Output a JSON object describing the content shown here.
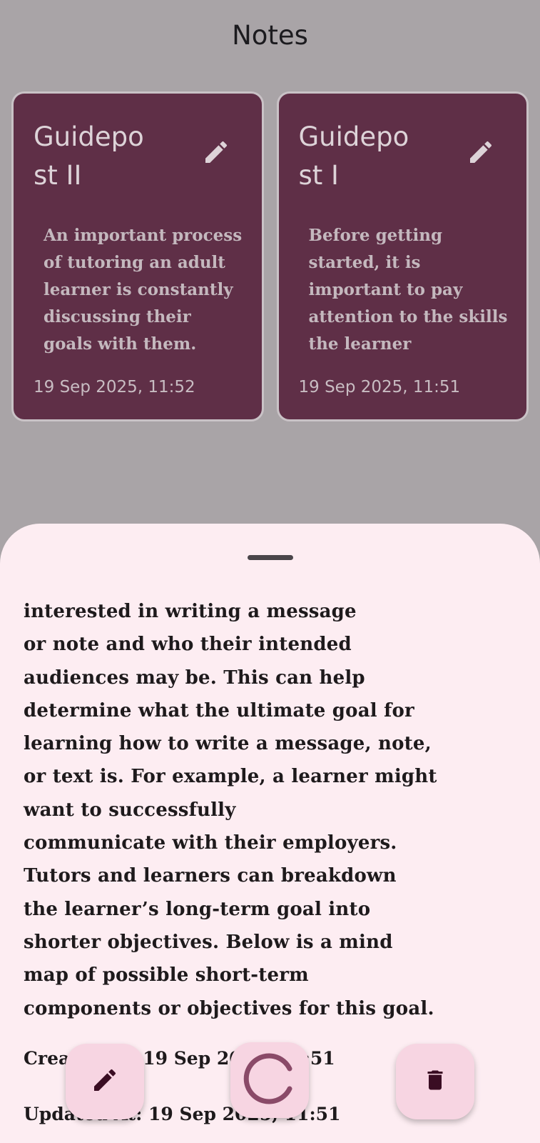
{
  "header": {
    "title": "Notes"
  },
  "notes": [
    {
      "title": "Guidepost II",
      "preview": "An important process of tutoring an adult learner is constantly discussing their goals with them.",
      "date": "19 Sep 2025, 11:52",
      "edit_icon": "pencil-icon"
    },
    {
      "title": "Guidepost I",
      "preview": "Before getting started, it is important to pay attention to the skills the learner",
      "date": "19 Sep 2025, 11:51",
      "edit_icon": "pencil-icon"
    }
  ],
  "sheet": {
    "body": "interested in writing a message\nor note and who their intended\naudiences may be. This can help\ndetermine what the ultimate goal for\nlearning how to write a message, note,\nor text is. For example, a learner might\nwant to successfully\ncommunicate with their employers.\nTutors and learners can breakdown\nthe learner’s long-term goal into\nshorter objectives. Below is a mind\nmap of possible short-term\ncomponents or objectives for this goal.",
    "created_label": "Created At: 19 Sep 2025, 11:51",
    "updated_label": "Updated At: 19 Sep 2025, 11:51"
  },
  "actions": {
    "edit_icon": "pencil-icon",
    "progress_icon": "loading-spinner-icon",
    "delete_icon": "trash-icon"
  },
  "colors": {
    "card_bg": "#5f2f47",
    "sheet_bg": "#fdedf2",
    "fab_bg": "#f7d5e2",
    "spinner": "#8a4a68"
  }
}
